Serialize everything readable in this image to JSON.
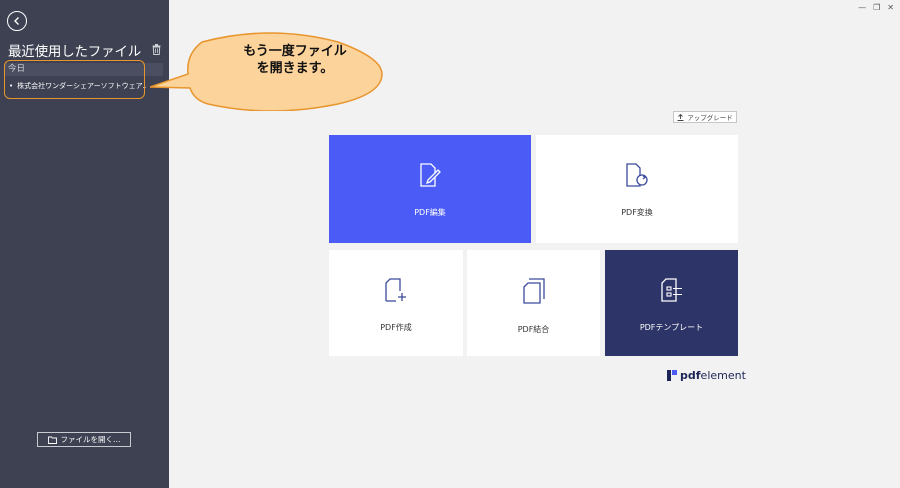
{
  "sidebar": {
    "title": "最近使用したファイル",
    "section_today": "今日",
    "recent_files": [
      "株式会社ワンダーシェアーソフトウェア..."
    ],
    "open_file_label": "ファイルを開く…"
  },
  "callout": {
    "line1": "もう一度ファイル",
    "line2": "を開きます。"
  },
  "main": {
    "upgrade_label": "アップグレード",
    "tiles": [
      {
        "label": "PDF編集",
        "icon": "edit-document-icon"
      },
      {
        "label": "PDF変換",
        "icon": "convert-document-icon"
      },
      {
        "label": "PDF作成",
        "icon": "create-document-icon"
      },
      {
        "label": "PDF結合",
        "icon": "combine-documents-icon"
      },
      {
        "label": "PDFテンプレート",
        "icon": "template-icon"
      }
    ],
    "logo_bold": "pdf",
    "logo_light": "element"
  },
  "colors": {
    "sidebar_bg": "#3d4152",
    "accent_blue": "#4a5cf5",
    "navy": "#2d3467",
    "callout_fill": "#fcd39a",
    "callout_border": "#e8952e"
  }
}
